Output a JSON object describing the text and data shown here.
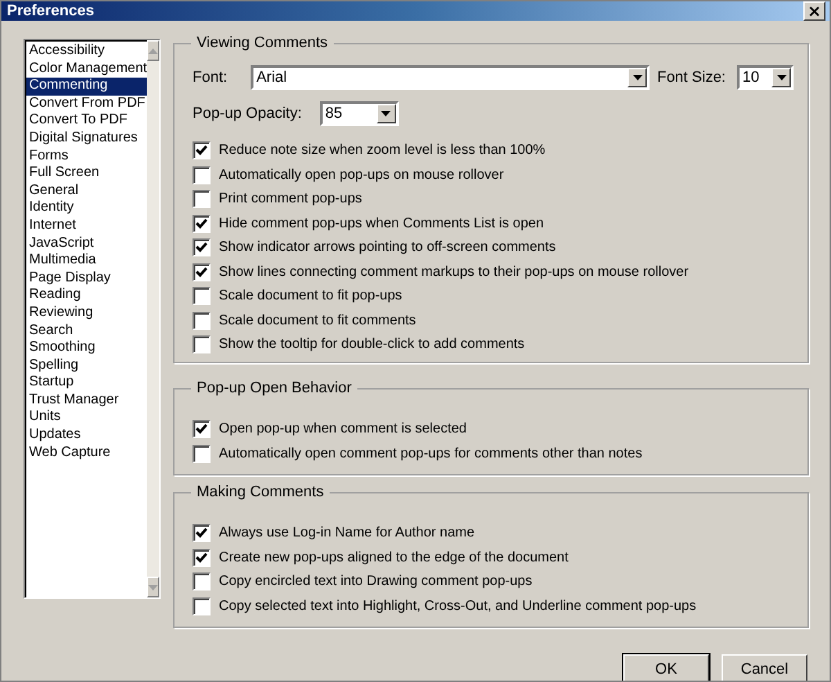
{
  "window": {
    "title": "Preferences",
    "close": "×"
  },
  "sidebar": {
    "items": [
      {
        "label": "Accessibility",
        "selected": false
      },
      {
        "label": "Color Management",
        "selected": false
      },
      {
        "label": "Commenting",
        "selected": true
      },
      {
        "label": "Convert From PDF",
        "selected": false
      },
      {
        "label": "Convert To PDF",
        "selected": false
      },
      {
        "label": "Digital Signatures",
        "selected": false
      },
      {
        "label": "Forms",
        "selected": false
      },
      {
        "label": "Full Screen",
        "selected": false
      },
      {
        "label": "General",
        "selected": false
      },
      {
        "label": "Identity",
        "selected": false
      },
      {
        "label": "Internet",
        "selected": false
      },
      {
        "label": "JavaScript",
        "selected": false
      },
      {
        "label": "Multimedia",
        "selected": false
      },
      {
        "label": "Page Display",
        "selected": false
      },
      {
        "label": "Reading",
        "selected": false
      },
      {
        "label": "Reviewing",
        "selected": false
      },
      {
        "label": "Search",
        "selected": false
      },
      {
        "label": "Smoothing",
        "selected": false
      },
      {
        "label": "Spelling",
        "selected": false
      },
      {
        "label": "Startup",
        "selected": false
      },
      {
        "label": "Trust Manager",
        "selected": false
      },
      {
        "label": "Units",
        "selected": false
      },
      {
        "label": "Updates",
        "selected": false
      },
      {
        "label": "Web Capture",
        "selected": false
      }
    ]
  },
  "groups": [
    {
      "title": "Viewing Comments",
      "font": {
        "label": "Font:",
        "value": "Arial"
      },
      "font_size": {
        "label": "Font Size:",
        "value": "10"
      },
      "opacity": {
        "label": "Pop-up Opacity:",
        "value": "85"
      },
      "options": [
        {
          "label": "Reduce note size when zoom level is less than 100%",
          "checked": true
        },
        {
          "label": "Automatically open pop-ups on mouse rollover",
          "checked": false
        },
        {
          "label": "Print comment pop-ups",
          "checked": false
        },
        {
          "label": "Hide comment pop-ups when Comments List is open",
          "checked": true
        },
        {
          "label": "Show indicator arrows pointing to off-screen comments",
          "checked": true
        },
        {
          "label": "Show lines connecting comment markups to their pop-ups on mouse rollover",
          "checked": true
        },
        {
          "label": "Scale document to fit pop-ups",
          "checked": false
        },
        {
          "label": "Scale document to fit comments",
          "checked": false
        },
        {
          "label": "Show the tooltip for double-click to add comments",
          "checked": false
        }
      ]
    },
    {
      "title": "Pop-up Open Behavior",
      "options": [
        {
          "label": "Open pop-up when comment is selected",
          "checked": true
        },
        {
          "label": "Automatically open comment pop-ups for comments other than notes",
          "checked": false
        }
      ]
    },
    {
      "title": "Making Comments",
      "options": [
        {
          "label": "Always use Log-in Name for Author name",
          "checked": true
        },
        {
          "label": "Create new pop-ups aligned to the edge of the document",
          "checked": true
        },
        {
          "label": "Copy encircled text into Drawing comment pop-ups",
          "checked": false
        },
        {
          "label": "Copy selected text into Highlight, Cross-Out, and Underline comment pop-ups",
          "checked": false
        }
      ]
    }
  ],
  "buttons": [
    {
      "label": "OK",
      "default": true
    },
    {
      "label": "Cancel",
      "default": false
    }
  ]
}
